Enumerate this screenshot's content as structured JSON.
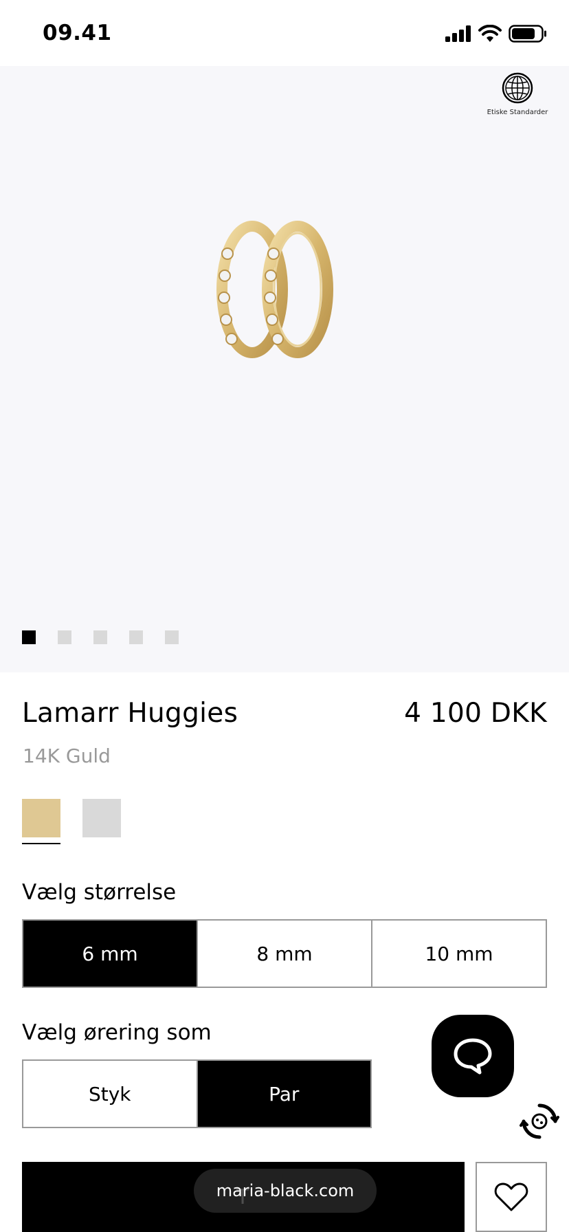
{
  "status_bar": {
    "time": "09.41"
  },
  "gallery": {
    "ethics_badge_label": "Etiske Standarder",
    "image_count": 5,
    "active_index": 0
  },
  "product": {
    "name": "Lamarr Huggies",
    "price": "4 100 DKK",
    "material": "14K Guld",
    "swatches": [
      {
        "color": "#dfc893",
        "selected": true
      },
      {
        "color": "#d9d9d9",
        "selected": false
      }
    ]
  },
  "size_selector": {
    "label": "Vælg størrelse",
    "options": [
      "6 mm",
      "8 mm",
      "10 mm"
    ],
    "selected": "6 mm"
  },
  "type_selector": {
    "label": "Vælg ørering som",
    "options": [
      "Styk",
      "Par"
    ],
    "selected": "Par"
  },
  "actions": {
    "add_to_bag_label": "T"
  },
  "browser": {
    "url": "maria-black.com"
  },
  "colors": {
    "accent": "#000000",
    "gallery_bg": "#f7f7fa",
    "gold": "#dfc893"
  }
}
